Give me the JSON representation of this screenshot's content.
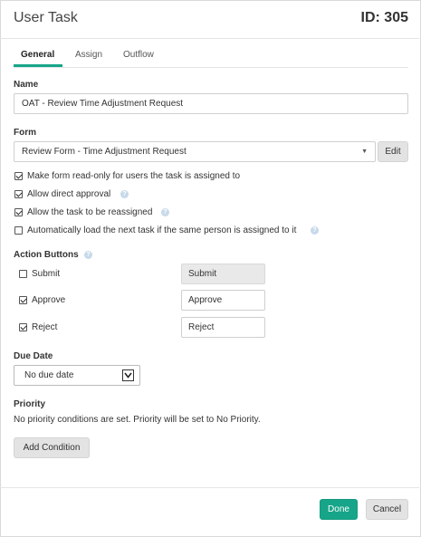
{
  "header": {
    "title": "User Task",
    "id_label": "ID: 305"
  },
  "tabs": [
    {
      "label": "General"
    },
    {
      "label": "Assign"
    },
    {
      "label": "Outflow"
    }
  ],
  "name": {
    "label": "Name",
    "value": "OAT - Review Time Adjustment Request"
  },
  "form": {
    "label": "Form",
    "value": "Review Form - Time Adjustment Request",
    "edit_label": "Edit"
  },
  "options": [
    {
      "label": "Make form read-only for users the task is assigned to",
      "checked": true,
      "help": false
    },
    {
      "label": "Allow direct approval",
      "checked": true,
      "help": true
    },
    {
      "label": "Allow the task to be reassigned",
      "checked": true,
      "help": true
    },
    {
      "label": "Automatically load the next task if the same person is assigned to it",
      "checked": false,
      "help": true
    }
  ],
  "action_buttons": {
    "label": "Action Buttons",
    "items": [
      {
        "name": "Submit",
        "checked": false,
        "text": "Submit"
      },
      {
        "name": "Approve",
        "checked": true,
        "text": "Approve"
      },
      {
        "name": "Reject",
        "checked": true,
        "text": "Reject"
      }
    ]
  },
  "due_date": {
    "label": "Due Date",
    "value": "No due date"
  },
  "priority": {
    "label": "Priority",
    "message": "No priority conditions are set. Priority will be set to No Priority.",
    "add_label": "Add Condition"
  },
  "footer": {
    "done_label": "Done",
    "cancel_label": "Cancel"
  },
  "colors": {
    "accent": "#17a589",
    "help": "#c7d9ea"
  },
  "icons": {
    "help": "help-circle-icon",
    "dropdown": "caret-down-icon",
    "check": "checkmark-icon"
  }
}
